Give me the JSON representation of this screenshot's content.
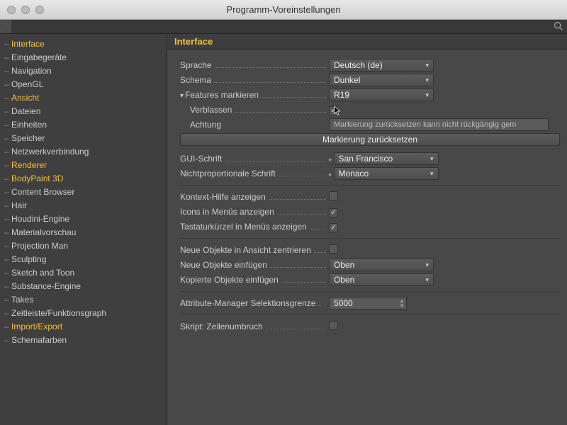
{
  "window": {
    "title": "Programm-Voreinstellungen"
  },
  "sidebar": {
    "items": [
      {
        "label": "Interface",
        "hl": true
      },
      {
        "label": "Eingabegeräte"
      },
      {
        "label": "Navigation"
      },
      {
        "label": "OpenGL"
      },
      {
        "label": "Ansicht",
        "hl": true
      },
      {
        "label": "Dateien"
      },
      {
        "label": "Einheiten"
      },
      {
        "label": "Speicher"
      },
      {
        "label": "Netzwerkverbindung"
      },
      {
        "label": "Renderer",
        "hl": true
      },
      {
        "label": "BodyPaint 3D",
        "hl": true
      },
      {
        "label": "Content Browser"
      },
      {
        "label": "Hair"
      },
      {
        "label": "Houdini-Engine"
      },
      {
        "label": "Materialvorschau"
      },
      {
        "label": "Projection Man"
      },
      {
        "label": "Sculpting"
      },
      {
        "label": "Sketch and Toon"
      },
      {
        "label": "Substance-Engine"
      },
      {
        "label": "Takes"
      },
      {
        "label": "Zeitleiste/Funktionsgraph"
      },
      {
        "label": "Import/Export",
        "hl": true
      },
      {
        "label": "Schemafarben"
      }
    ]
  },
  "main": {
    "heading": "Interface",
    "labels": {
      "sprache": "Sprache",
      "schema": "Schema",
      "features": "Features markieren",
      "verblassen": "Verblassen",
      "achtung": "Achtung",
      "reset": "Markierung zurücksetzen",
      "gui_schrift": "GUI-Schrift",
      "mono_schrift": "Nichtproportionale Schrift",
      "kontext": "Kontext-Hilfe anzeigen",
      "icons": "Icons in Menüs anzeigen",
      "tastatur": "Tastaturkürzel in Menüs anzeigen",
      "neue_zentr": "Neue Objekte in Ansicht zentrieren",
      "neue_einf": "Neue Objekte einfügen",
      "kop_einf": "Kopierte Objekte einfügen",
      "attr_limit": "Attribute-Manager Selektionsgrenze",
      "skript": "Skript: Zeilenumbruch"
    },
    "values": {
      "sprache": "Deutsch (de)",
      "schema": "Dunkel",
      "features": "R19",
      "verblassen": true,
      "achtung_info": "Markierung zurücksetzen kann nicht rückgängig gem",
      "gui_schrift": "San Francisco",
      "mono_schrift": "Monaco",
      "kontext": false,
      "icons": true,
      "tastatur": true,
      "neue_zentr": false,
      "neue_einf": "Oben",
      "kop_einf": "Oben",
      "attr_limit": "5000",
      "skript": false
    }
  }
}
